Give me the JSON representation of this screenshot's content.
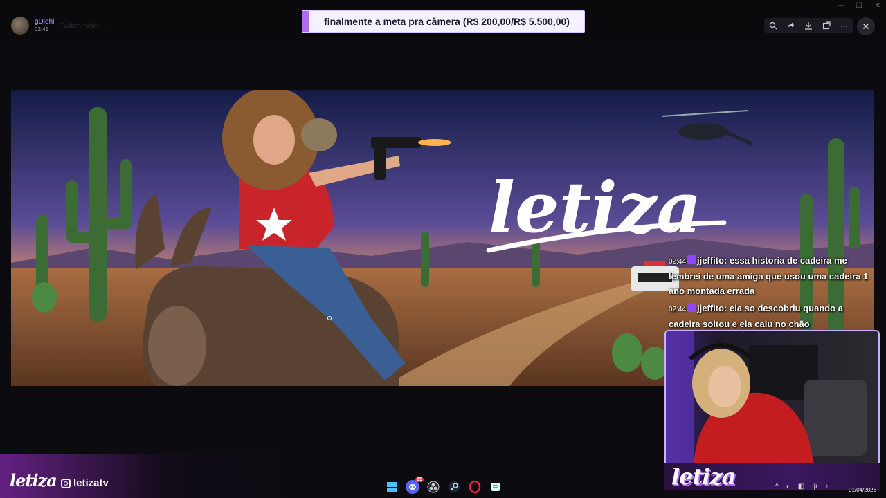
{
  "app": {
    "user": {
      "name": "gDiehl",
      "time": "02:41"
    },
    "channel": "Twitch.tv/leti..."
  },
  "goal": {
    "text": "finalmente a meta pra câmera (R$ 200,00/R$ 5.500,00)"
  },
  "toolbar": {
    "icons": [
      "zoom-icon",
      "forward-icon",
      "download-icon",
      "open-external-icon",
      "more-icon"
    ],
    "close_icon": "close-icon"
  },
  "banner": {
    "title": "letiza",
    "colors": {
      "sky_top": "#1a2350",
      "sky_mid": "#6b5aa8",
      "horizon": "#f0a060",
      "ground": "#b07a48",
      "cactus": "#3d6b35"
    }
  },
  "chat": {
    "messages": [
      {
        "time": "02:44",
        "user": "jjeffito",
        "text": "essa historia de cadeira me lembrei de uma amiga que usou uma cadeira 1 ano montada errada"
      },
      {
        "time": "02:44",
        "user": "jjeffito",
        "text": "ela so descobriu quando a cadeira soltou e ela caiu no chão"
      }
    ]
  },
  "webcam": {
    "overlay_logo": "letiza"
  },
  "branding": {
    "logo": "letiza",
    "instagram_handle": "letizatv"
  },
  "taskbar": {
    "apps": [
      "windows-start-icon",
      "discord-icon",
      "obs-icon",
      "steam-icon",
      "opera-gx-icon",
      "notepad-icon"
    ],
    "discord_badge": "25",
    "date": "01/04/2026"
  }
}
